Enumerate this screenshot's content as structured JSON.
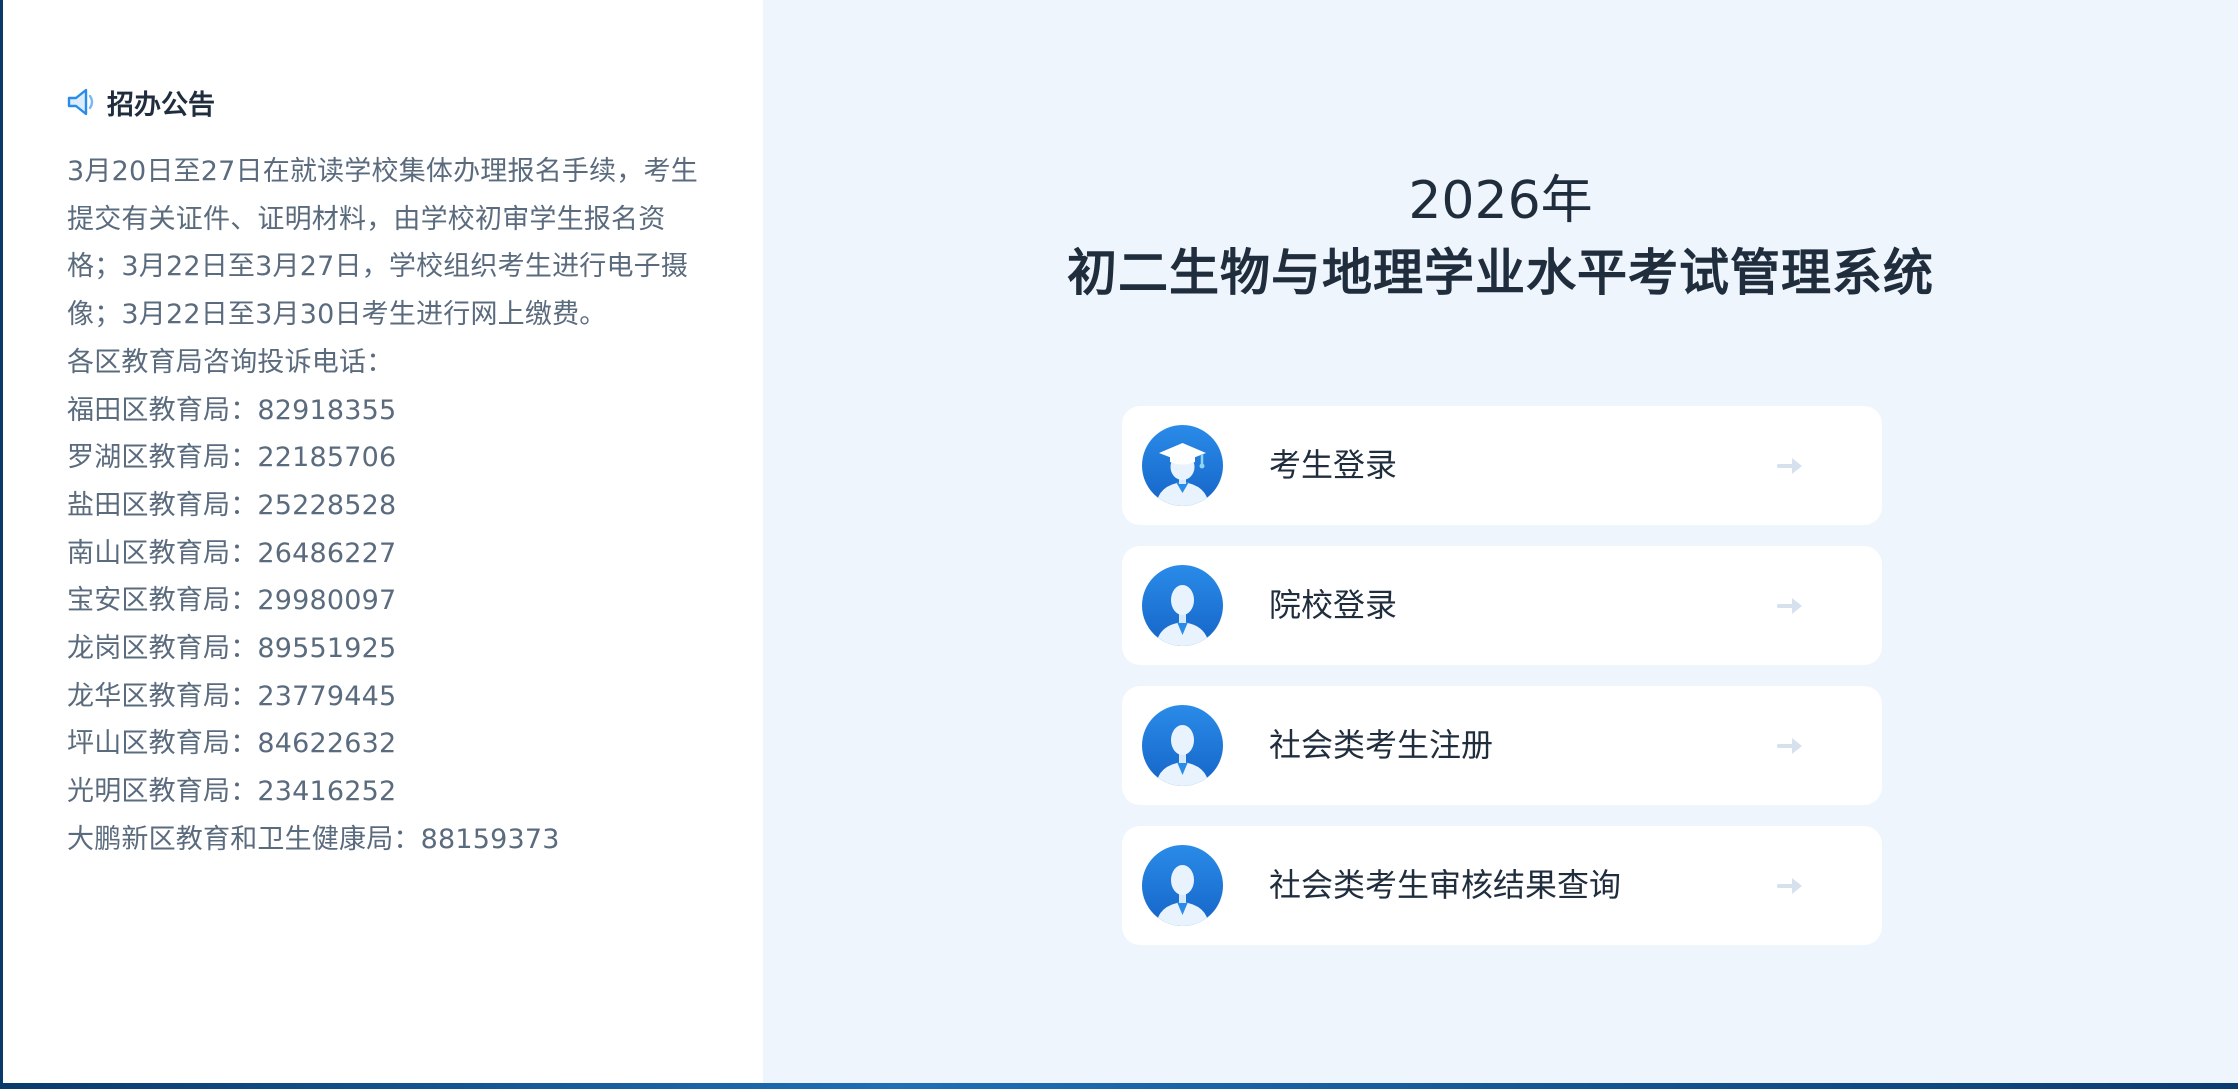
{
  "notice": {
    "title": "招办公告",
    "paragraph": "3月20日至27日在就读学校集体办理报名手续，考生提交有关证件、证明材料，由学校初审学生报名资格；3月22日至3月27日，学校组织考生进行电子摄像；3月22日至3月30日考生进行网上缴费。",
    "hotline_heading": "各区教育局咨询投诉电话：",
    "phones": [
      "福田区教育局：82918355",
      "罗湖区教育局：22185706",
      "盐田区教育局：25228528",
      "南山区教育局：26486227",
      "宝安区教育局：29980097",
      "龙岗区教育局：89551925",
      "龙华区教育局：23779445",
      "坪山区教育局：84622632",
      "光明区教育局：23416252",
      "大鹏新区教育和卫生健康局：88159373"
    ]
  },
  "header": {
    "year": "2026年",
    "title": "初二生物与地理学业水平考试管理系统"
  },
  "entries": [
    {
      "label": "考生登录",
      "icon": "graduate-avatar-icon"
    },
    {
      "label": "院校登录",
      "icon": "person-avatar-icon"
    },
    {
      "label": "社会类考生注册",
      "icon": "person-avatar-icon"
    },
    {
      "label": "社会类考生审核结果查询",
      "icon": "person-avatar-icon"
    }
  ],
  "colors": {
    "accent": "#1e7be0",
    "title_text": "#1f2d3d",
    "body_text": "#5b6b7e",
    "right_background": "#eef5fd"
  }
}
